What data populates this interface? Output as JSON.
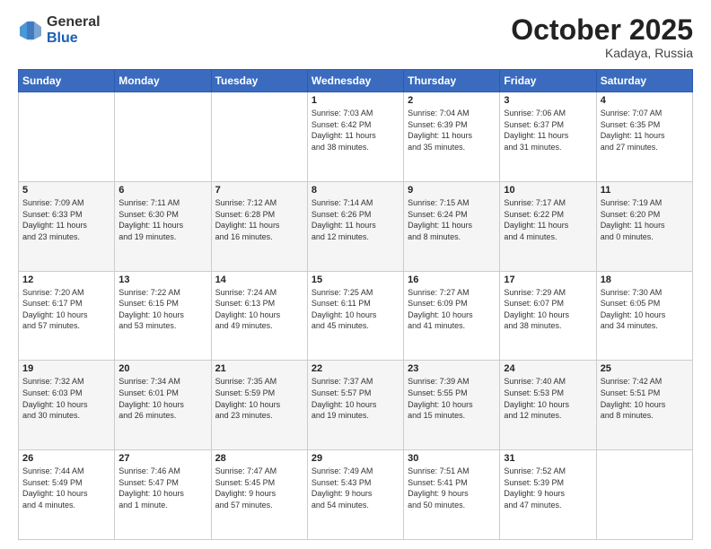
{
  "logo": {
    "general": "General",
    "blue": "Blue"
  },
  "header": {
    "month": "October 2025",
    "location": "Kadaya, Russia"
  },
  "days_of_week": [
    "Sunday",
    "Monday",
    "Tuesday",
    "Wednesday",
    "Thursday",
    "Friday",
    "Saturday"
  ],
  "weeks": [
    [
      {
        "day": "",
        "text": ""
      },
      {
        "day": "",
        "text": ""
      },
      {
        "day": "",
        "text": ""
      },
      {
        "day": "1",
        "text": "Sunrise: 7:03 AM\nSunset: 6:42 PM\nDaylight: 11 hours\nand 38 minutes."
      },
      {
        "day": "2",
        "text": "Sunrise: 7:04 AM\nSunset: 6:39 PM\nDaylight: 11 hours\nand 35 minutes."
      },
      {
        "day": "3",
        "text": "Sunrise: 7:06 AM\nSunset: 6:37 PM\nDaylight: 11 hours\nand 31 minutes."
      },
      {
        "day": "4",
        "text": "Sunrise: 7:07 AM\nSunset: 6:35 PM\nDaylight: 11 hours\nand 27 minutes."
      }
    ],
    [
      {
        "day": "5",
        "text": "Sunrise: 7:09 AM\nSunset: 6:33 PM\nDaylight: 11 hours\nand 23 minutes."
      },
      {
        "day": "6",
        "text": "Sunrise: 7:11 AM\nSunset: 6:30 PM\nDaylight: 11 hours\nand 19 minutes."
      },
      {
        "day": "7",
        "text": "Sunrise: 7:12 AM\nSunset: 6:28 PM\nDaylight: 11 hours\nand 16 minutes."
      },
      {
        "day": "8",
        "text": "Sunrise: 7:14 AM\nSunset: 6:26 PM\nDaylight: 11 hours\nand 12 minutes."
      },
      {
        "day": "9",
        "text": "Sunrise: 7:15 AM\nSunset: 6:24 PM\nDaylight: 11 hours\nand 8 minutes."
      },
      {
        "day": "10",
        "text": "Sunrise: 7:17 AM\nSunset: 6:22 PM\nDaylight: 11 hours\nand 4 minutes."
      },
      {
        "day": "11",
        "text": "Sunrise: 7:19 AM\nSunset: 6:20 PM\nDaylight: 11 hours\nand 0 minutes."
      }
    ],
    [
      {
        "day": "12",
        "text": "Sunrise: 7:20 AM\nSunset: 6:17 PM\nDaylight: 10 hours\nand 57 minutes."
      },
      {
        "day": "13",
        "text": "Sunrise: 7:22 AM\nSunset: 6:15 PM\nDaylight: 10 hours\nand 53 minutes."
      },
      {
        "day": "14",
        "text": "Sunrise: 7:24 AM\nSunset: 6:13 PM\nDaylight: 10 hours\nand 49 minutes."
      },
      {
        "day": "15",
        "text": "Sunrise: 7:25 AM\nSunset: 6:11 PM\nDaylight: 10 hours\nand 45 minutes."
      },
      {
        "day": "16",
        "text": "Sunrise: 7:27 AM\nSunset: 6:09 PM\nDaylight: 10 hours\nand 41 minutes."
      },
      {
        "day": "17",
        "text": "Sunrise: 7:29 AM\nSunset: 6:07 PM\nDaylight: 10 hours\nand 38 minutes."
      },
      {
        "day": "18",
        "text": "Sunrise: 7:30 AM\nSunset: 6:05 PM\nDaylight: 10 hours\nand 34 minutes."
      }
    ],
    [
      {
        "day": "19",
        "text": "Sunrise: 7:32 AM\nSunset: 6:03 PM\nDaylight: 10 hours\nand 30 minutes."
      },
      {
        "day": "20",
        "text": "Sunrise: 7:34 AM\nSunset: 6:01 PM\nDaylight: 10 hours\nand 26 minutes."
      },
      {
        "day": "21",
        "text": "Sunrise: 7:35 AM\nSunset: 5:59 PM\nDaylight: 10 hours\nand 23 minutes."
      },
      {
        "day": "22",
        "text": "Sunrise: 7:37 AM\nSunset: 5:57 PM\nDaylight: 10 hours\nand 19 minutes."
      },
      {
        "day": "23",
        "text": "Sunrise: 7:39 AM\nSunset: 5:55 PM\nDaylight: 10 hours\nand 15 minutes."
      },
      {
        "day": "24",
        "text": "Sunrise: 7:40 AM\nSunset: 5:53 PM\nDaylight: 10 hours\nand 12 minutes."
      },
      {
        "day": "25",
        "text": "Sunrise: 7:42 AM\nSunset: 5:51 PM\nDaylight: 10 hours\nand 8 minutes."
      }
    ],
    [
      {
        "day": "26",
        "text": "Sunrise: 7:44 AM\nSunset: 5:49 PM\nDaylight: 10 hours\nand 4 minutes."
      },
      {
        "day": "27",
        "text": "Sunrise: 7:46 AM\nSunset: 5:47 PM\nDaylight: 10 hours\nand 1 minute."
      },
      {
        "day": "28",
        "text": "Sunrise: 7:47 AM\nSunset: 5:45 PM\nDaylight: 9 hours\nand 57 minutes."
      },
      {
        "day": "29",
        "text": "Sunrise: 7:49 AM\nSunset: 5:43 PM\nDaylight: 9 hours\nand 54 minutes."
      },
      {
        "day": "30",
        "text": "Sunrise: 7:51 AM\nSunset: 5:41 PM\nDaylight: 9 hours\nand 50 minutes."
      },
      {
        "day": "31",
        "text": "Sunrise: 7:52 AM\nSunset: 5:39 PM\nDaylight: 9 hours\nand 47 minutes."
      },
      {
        "day": "",
        "text": ""
      }
    ]
  ]
}
